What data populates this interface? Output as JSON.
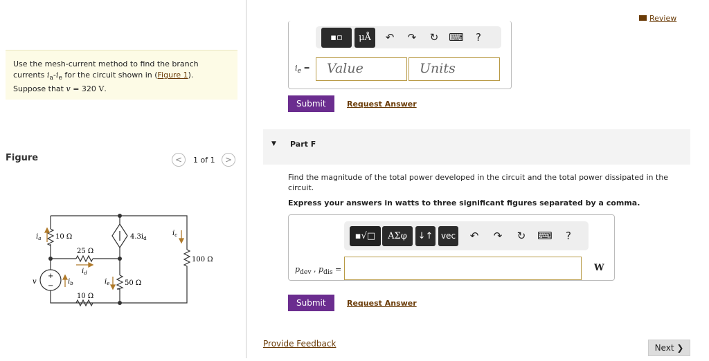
{
  "review": "Review",
  "problem": {
    "text1": "Use the mesh-current method to find the branch",
    "text2a": "currents ",
    "ia": "i",
    "ia_sub": "a",
    "dash": "-",
    "ie": "i",
    "ie_sub": "e",
    "text2b": " for the circuit shown in (",
    "fig_link": "Figure 1",
    "text2c": ").",
    "text3a": "Suppose that ",
    "v": "v",
    "text3b": " = 320 ",
    "unit": "V",
    "text3c": "."
  },
  "figure": {
    "label": "Figure",
    "page": "1 of 1",
    "prev": "<",
    "next": ">"
  },
  "circuit": {
    "r_top_left": "10 Ω",
    "dep_source": "4.3i",
    "dep_sub": "d",
    "r_mid": "25 Ω",
    "r_right": "100 Ω",
    "r_center": "50 Ω",
    "r_bottom": "10 Ω",
    "ia": "i",
    "ia_sub": "a",
    "ib": "i",
    "ib_sub": "b",
    "ic": "i",
    "ic_sub": "c",
    "id": "i",
    "id_sub": "d",
    "ie": "i",
    "ie_sub": "e",
    "v": "v",
    "plus": "+",
    "minus": "−"
  },
  "part_e": {
    "toolbar": {
      "templates": "▪▫",
      "units": "μÅ",
      "undo": "↶",
      "redo": "↷",
      "reset": "↻",
      "keyboard": "⌨",
      "help": "?"
    },
    "label": "i",
    "label_sub": "e",
    "eq": " =",
    "value_placeholder": "Value",
    "units_placeholder": "Units",
    "submit": "Submit",
    "request": "Request Answer"
  },
  "part_f": {
    "title": "Part F",
    "arrow": "▼",
    "question": "Find the magnitude of the total power developed in the circuit and the total power dissipated in the circuit.",
    "instruction": "Express your answers in watts to three significant figures separated by a comma.",
    "toolbar": {
      "templates": "▪√□",
      "greek": "ΑΣφ",
      "arrows": "↓↑",
      "vec": "vec",
      "undo": "↶",
      "redo": "↷",
      "reset": "↻",
      "keyboard": "⌨",
      "help": "?"
    },
    "label": "p",
    "sub1": "dev",
    "comma": " , ",
    "sub2": "dis",
    "eq": " =",
    "unit": "W",
    "submit": "Submit",
    "request": "Request Answer"
  },
  "footer": {
    "feedback": "Provide Feedback",
    "next": "Next ❯"
  }
}
